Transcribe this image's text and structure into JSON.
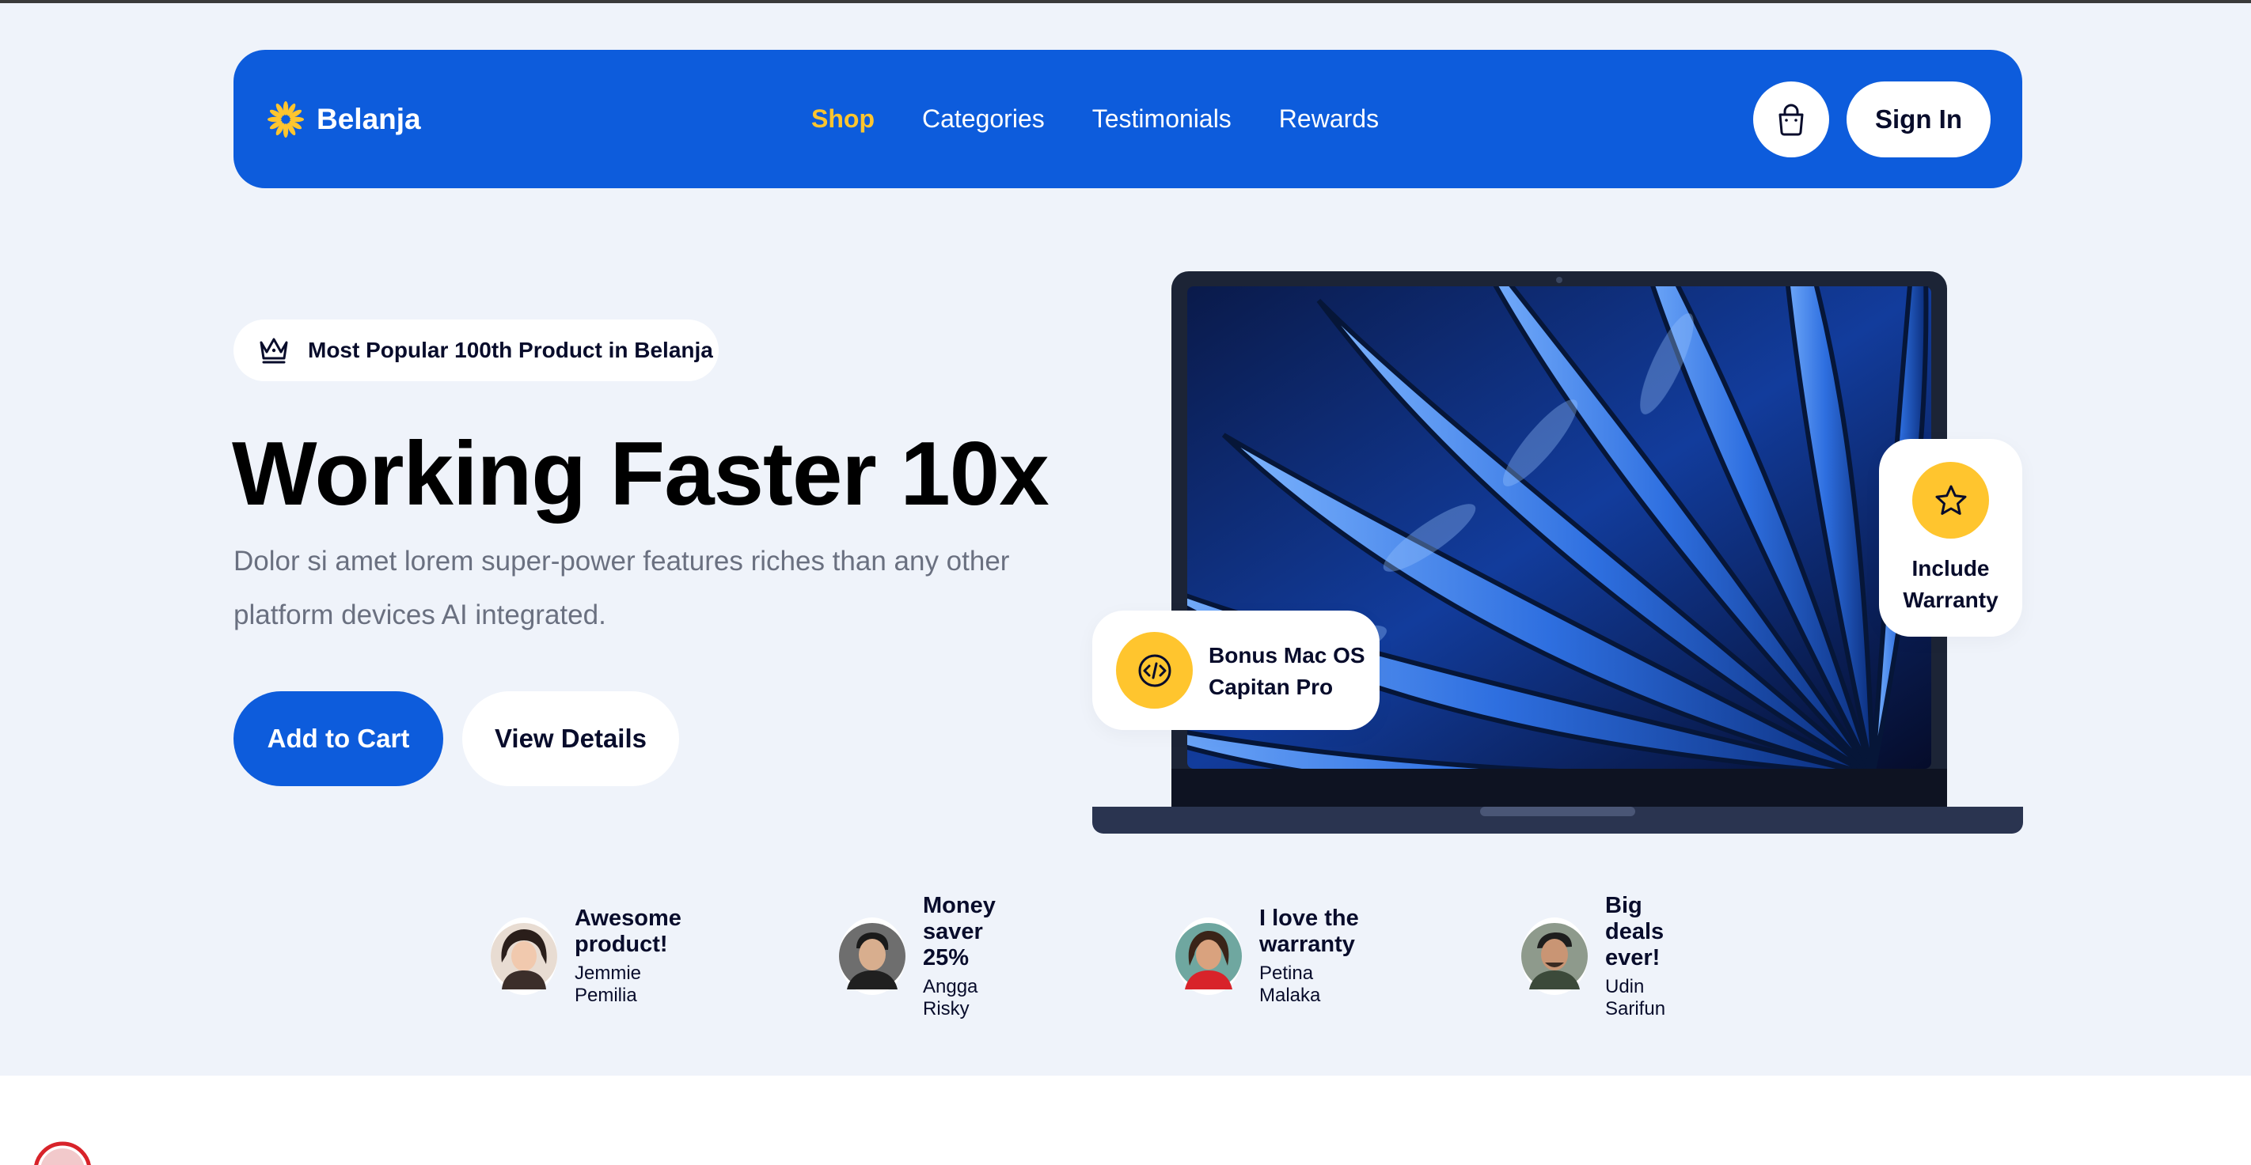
{
  "brand": {
    "name": "Belanja",
    "logo_icon": "sun-flower-icon",
    "logo_color": "#FFC52E"
  },
  "nav": {
    "links": [
      {
        "label": "Shop",
        "active": true
      },
      {
        "label": "Categories",
        "active": false
      },
      {
        "label": "Testimonials",
        "active": false
      },
      {
        "label": "Rewards",
        "active": false
      }
    ],
    "cart_icon": "shopping-bag-icon",
    "signin_label": "Sign In"
  },
  "hero": {
    "badge_icon": "crown-icon",
    "badge_text": "Most Popular 100th Product in Belanja",
    "title": "Working Faster 10x",
    "subtitle": "Dolor si amet lorem super-power features riches than any other platform devices AI integrated.",
    "primary_button": "Add to Cart",
    "secondary_button": "View Details",
    "product_image": "laptop-image"
  },
  "feature_cards": {
    "bonus": {
      "icon": "code-icon",
      "line1": "Bonus Mac OS",
      "line2": "Capitan Pro"
    },
    "warranty": {
      "icon": "star-icon",
      "line1": "Include",
      "line2": "Warranty"
    }
  },
  "testimonials": [
    {
      "quote": "Awesome product!",
      "name": "Jemmie Pemilia"
    },
    {
      "quote": "Money saver 25%",
      "name": "Angga Risky"
    },
    {
      "quote": "I love the warranty",
      "name": "Petina Malaka"
    },
    {
      "quote": "Big deals ever!",
      "name": "Udin Sarifun"
    }
  ],
  "colors": {
    "primary": "#0D5CDC",
    "accent": "#FFC52E",
    "hero_background": "#EFF3FA",
    "text_dark": "#080C2B",
    "text_muted": "#6A7080"
  }
}
